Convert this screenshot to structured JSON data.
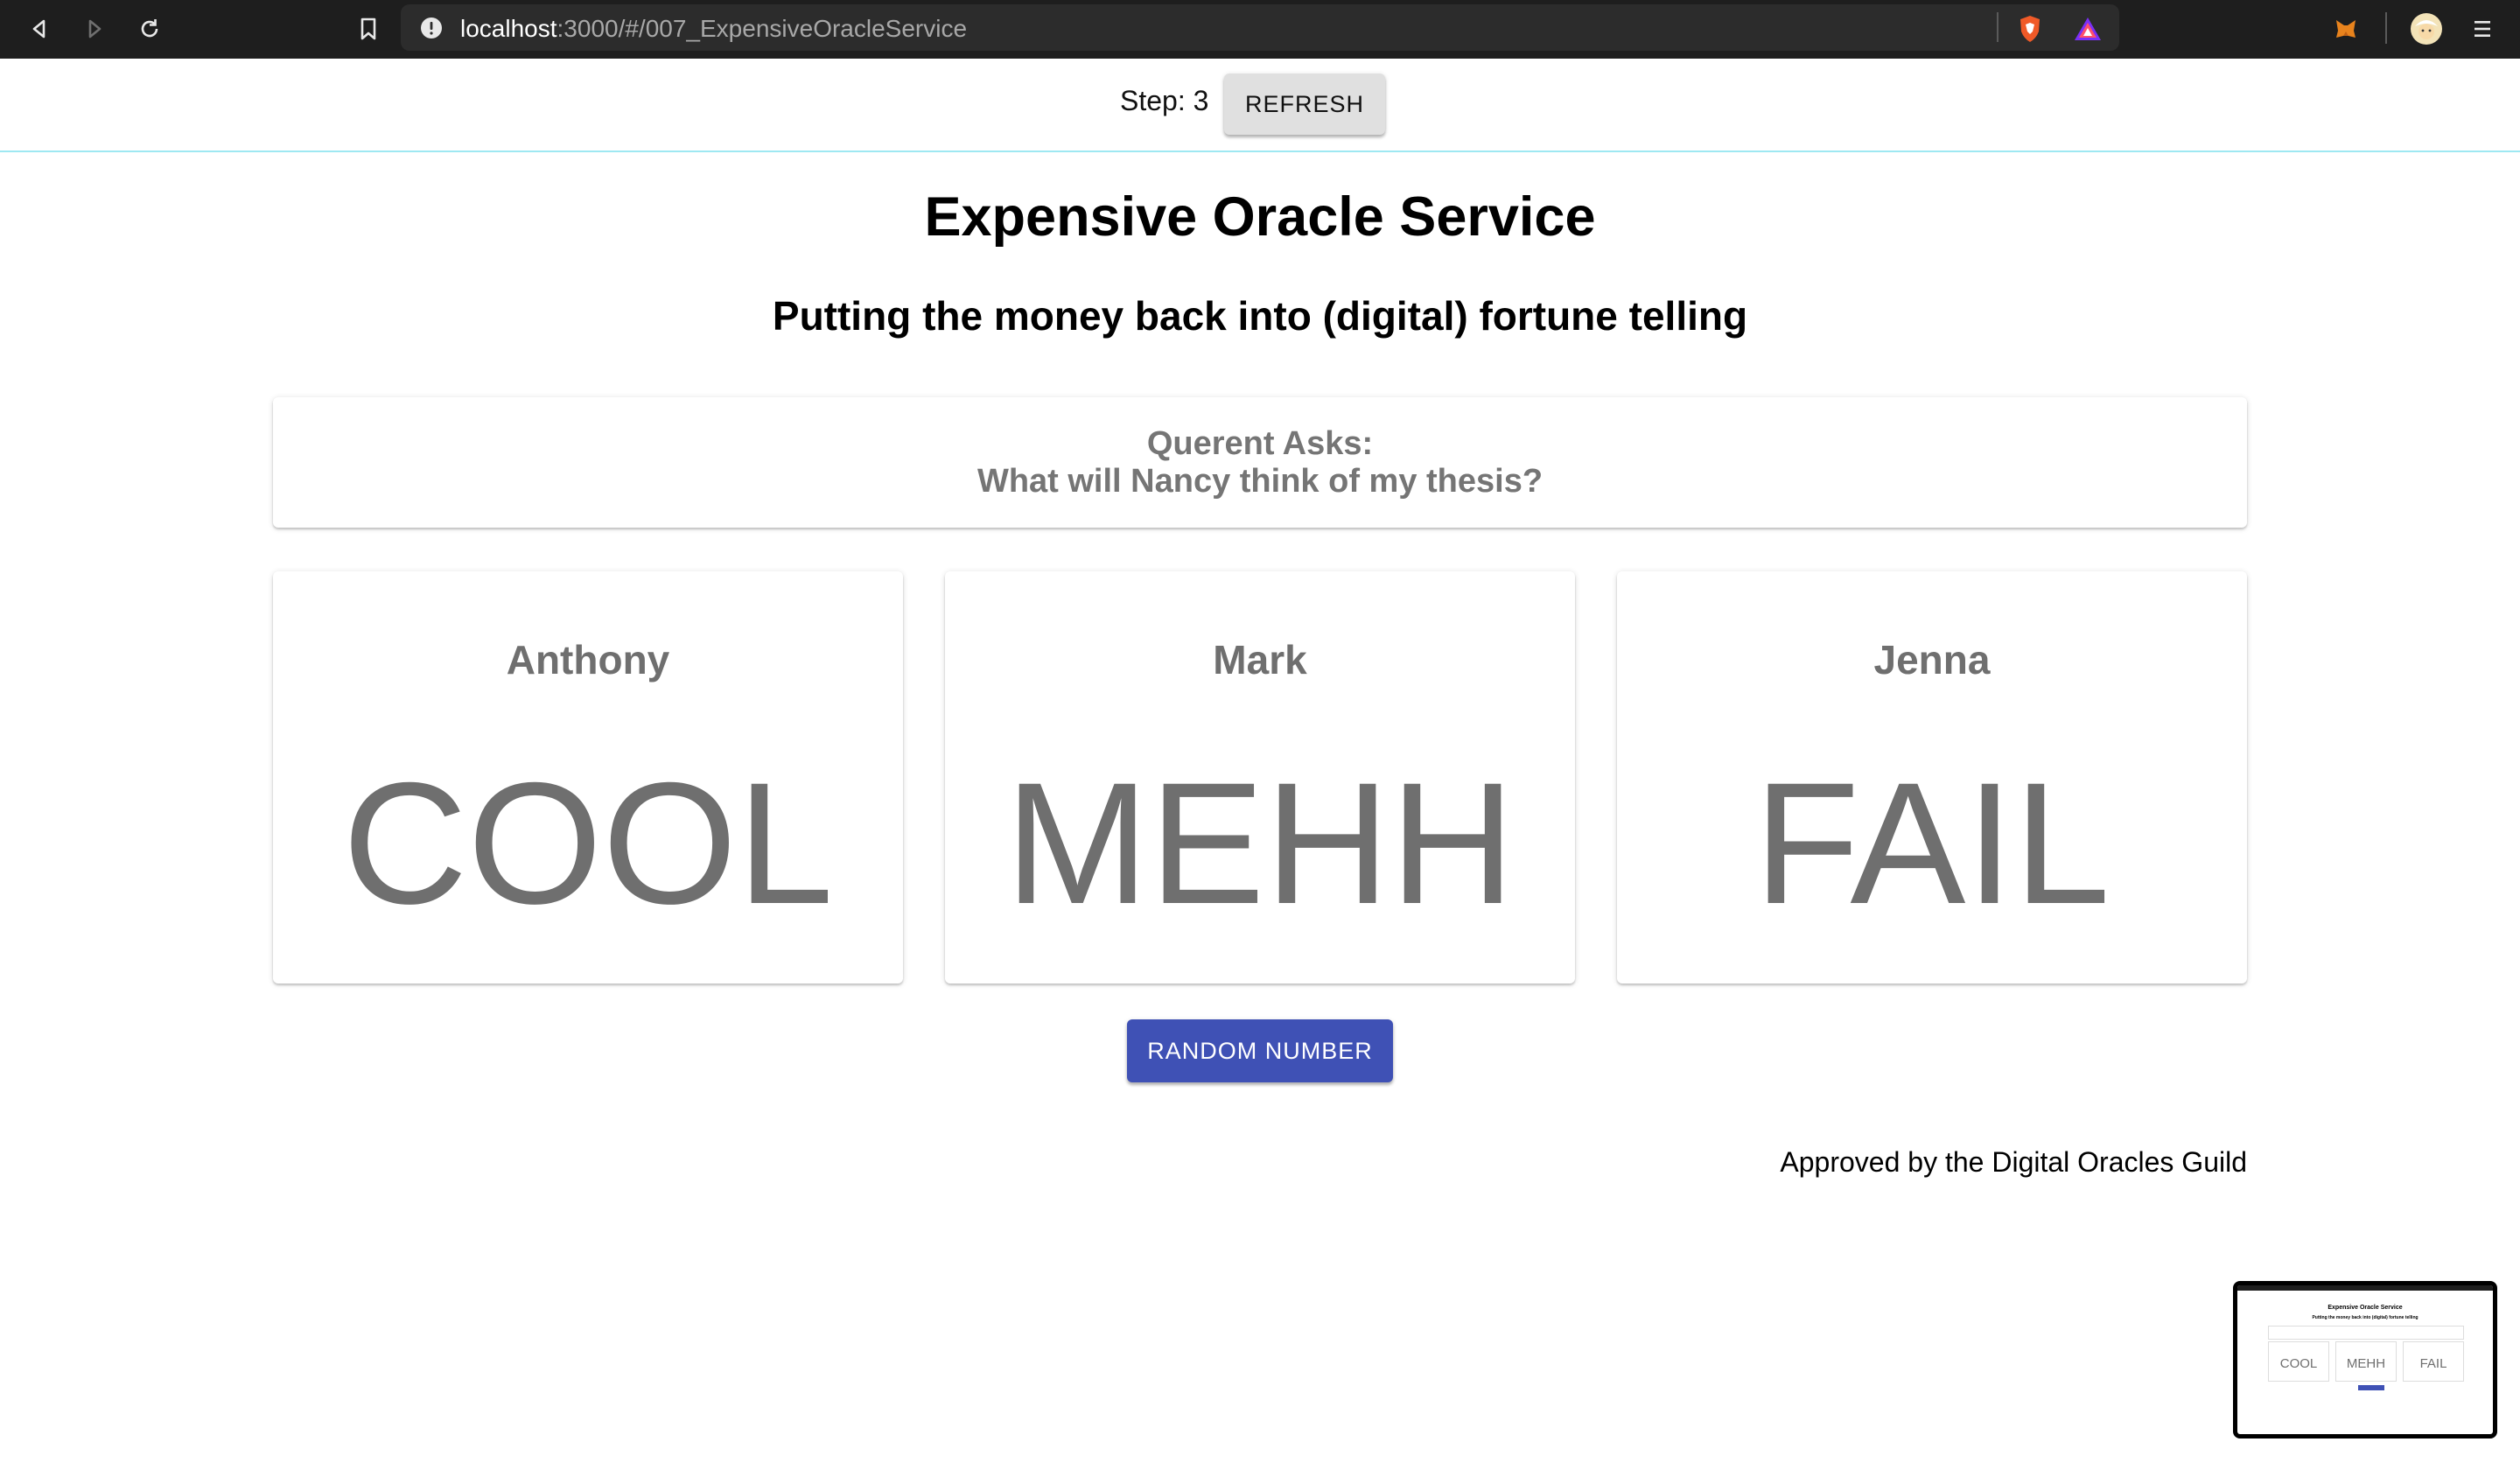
{
  "browser": {
    "url_host": "localhost",
    "url_rest": ":3000/#/007_ExpensiveOracleService"
  },
  "appbar": {
    "step_label": "Step: 3",
    "refresh_label": "REFRESH"
  },
  "main": {
    "title": "Expensive Oracle Service",
    "subtitle": "Putting the money back into (digital) fortune telling",
    "question_heading": "Querent Asks:",
    "question_text": "What will Nancy think of my thesis?",
    "oracles": [
      {
        "name": "Anthony",
        "answer": "COOL"
      },
      {
        "name": "Mark",
        "answer": "MEHH"
      },
      {
        "name": "Jenna",
        "answer": "FAIL"
      }
    ],
    "random_button_label": "RANDOM NUMBER",
    "footer_note": "Approved by the Digital Oracles Guild"
  },
  "colors": {
    "primary_button": "#3f51b5",
    "default_button": "#e0e0e0",
    "appbar_border": "#9ee8f2",
    "card_text": "#6f6f6f"
  }
}
